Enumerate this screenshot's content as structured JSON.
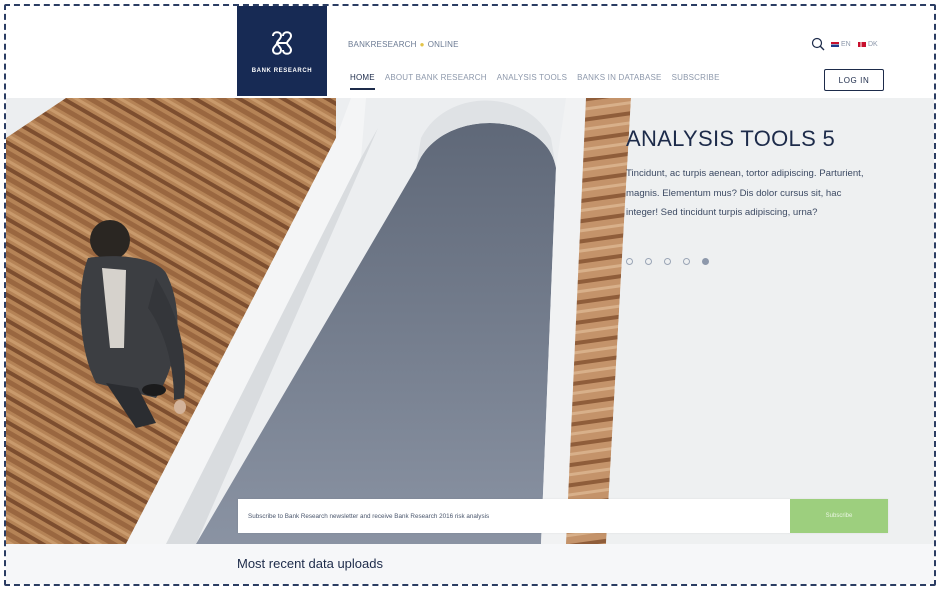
{
  "header": {
    "logo_text": "BANK RESEARCH",
    "site_name": "BANKRESEARCH",
    "site_separator": "●",
    "site_status": "ONLINE",
    "nav": [
      {
        "label": "HOME",
        "active": true
      },
      {
        "label": "ABOUT BANK RESEARCH",
        "active": false
      },
      {
        "label": "ANALYSIS TOOLS",
        "active": false
      },
      {
        "label": "BANKS IN DATABASE",
        "active": false
      },
      {
        "label": "SUBSCRIBE",
        "active": false
      }
    ],
    "languages": [
      {
        "code": "EN",
        "flag_color": "#c8102e"
      },
      {
        "code": "DK",
        "flag_color": "#c8102e"
      }
    ],
    "login_label": "LOG IN",
    "search_icon": "search-icon"
  },
  "hero": {
    "title": "ANALYSIS TOOLS 5",
    "text": "Tincidunt, ac turpis aenean, tortor adipiscing. Parturient, magnis. Elementum mus? Dis dolor cursus sit, hac integer! Sed tincidunt turpis adipiscing, urna?",
    "slides_total": 5,
    "active_slide": 5
  },
  "newsletter": {
    "text": "Subscribe to Bank Research newsletter and receive Bank Research 2016 risk analysis",
    "button_label": "Subscribe"
  },
  "recent": {
    "title": "Most recent data uploads"
  },
  "colors": {
    "brand_navy": "#172a54",
    "subscribe_green": "#9dcf7e",
    "accent_yellow": "#e3c44a"
  }
}
